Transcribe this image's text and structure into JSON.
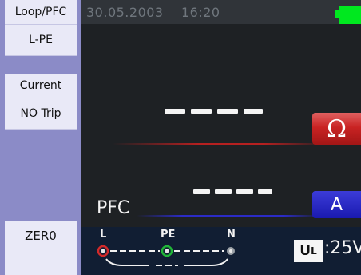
{
  "sidebar": {
    "items": [
      {
        "label": "Loop/PFC"
      },
      {
        "label": "L-PE"
      },
      {
        "label": ""
      },
      {
        "label": "Current"
      },
      {
        "label": "NO Trip"
      }
    ],
    "zero_label": "ZER0"
  },
  "status": {
    "datetime": "30.05.2003    16:20"
  },
  "display": {
    "primary_reading": "----",
    "primary_unit": "Ω",
    "secondary_reading": "----",
    "secondary_unit": "A",
    "mode_label": "PFC"
  },
  "connection": {
    "terminals": [
      "L",
      "PE",
      "N"
    ],
    "ul_label": "U",
    "ul_subscript": "L",
    "ul_value": ":25V"
  }
}
